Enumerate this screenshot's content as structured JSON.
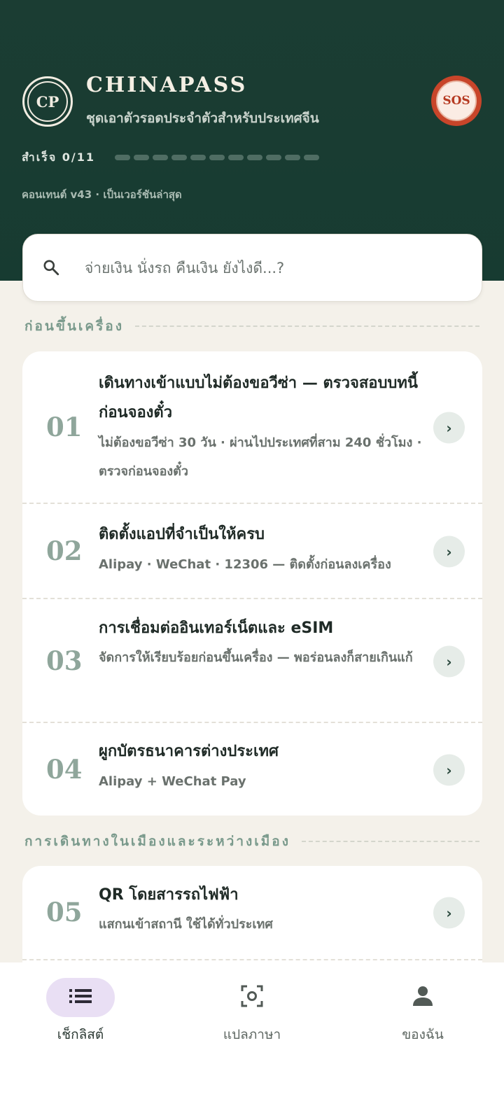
{
  "header": {
    "logo_text": "CP",
    "app_title": "CHINAPASS",
    "app_subtitle": "ชุดเอาตัวรอดประจำตัวสำหรับประเทศจีน",
    "sos_label": "SOS",
    "progress_label": "สำเร็จ 0/11",
    "progress": {
      "completed": 0,
      "total": 11
    },
    "version_text": "คอนเทนต์ v43 · เป็นเวอร์ชันล่าสุด"
  },
  "search": {
    "placeholder": "จ่ายเงิน นั่งรถ คืนเงิน ยังไงดี...?",
    "icon": "search-icon"
  },
  "sections": [
    {
      "title": "ก่อนขึ้นเครื่อง",
      "items": [
        {
          "num": "01",
          "title": "เดินทางเข้าแบบไม่ต้องขอวีซ่า — ตรวจสอบบทนี้ก่อนจองตั๋ว",
          "subtitle": "ไม่ต้องขอวีซ่า 30 วัน · ผ่านไปประเทศที่สาม 240 ชั่วโมง · ตรวจก่อนจองตั๋ว"
        },
        {
          "num": "02",
          "title": "ติดตั้งแอปที่จำเป็นให้ครบ",
          "subtitle": "Alipay · WeChat · 12306 — ติดตั้งก่อนลงเครื่อง"
        },
        {
          "num": "03",
          "title": "การเชื่อมต่ออินเทอร์เน็ตและ eSIM",
          "subtitle": "จัดการให้เรียบร้อยก่อนขึ้นเครื่อง — พอร่อนลงก็สายเกินแก้"
        },
        {
          "num": "04",
          "title": "ผูกบัตรธนาคารต่างประเทศ",
          "subtitle": "Alipay + WeChat Pay"
        }
      ]
    },
    {
      "title": "การเดินทางในเมืองและระหว่างเมือง",
      "items": [
        {
          "num": "05",
          "title": "QR โดยสารรถไฟฟ้า",
          "subtitle": "แสกนเข้าสถานี ใช้ได้ทั่วประเทศ"
        }
      ]
    }
  ],
  "chevron_glyph": "›",
  "bottom_nav": {
    "items": [
      {
        "label": "เช็กลิสต์",
        "icon": "list-icon",
        "active": true
      },
      {
        "label": "แปลภาษา",
        "icon": "scan-icon",
        "active": false
      },
      {
        "label": "ของฉัน",
        "icon": "person-icon",
        "active": false
      }
    ]
  },
  "colors": {
    "header_bg": "#1b3d33",
    "page_bg": "#f4f1ea",
    "sos": "#c8452a",
    "accent_muted": "#8fa69b",
    "nav_active_pill": "#e9dff4"
  }
}
